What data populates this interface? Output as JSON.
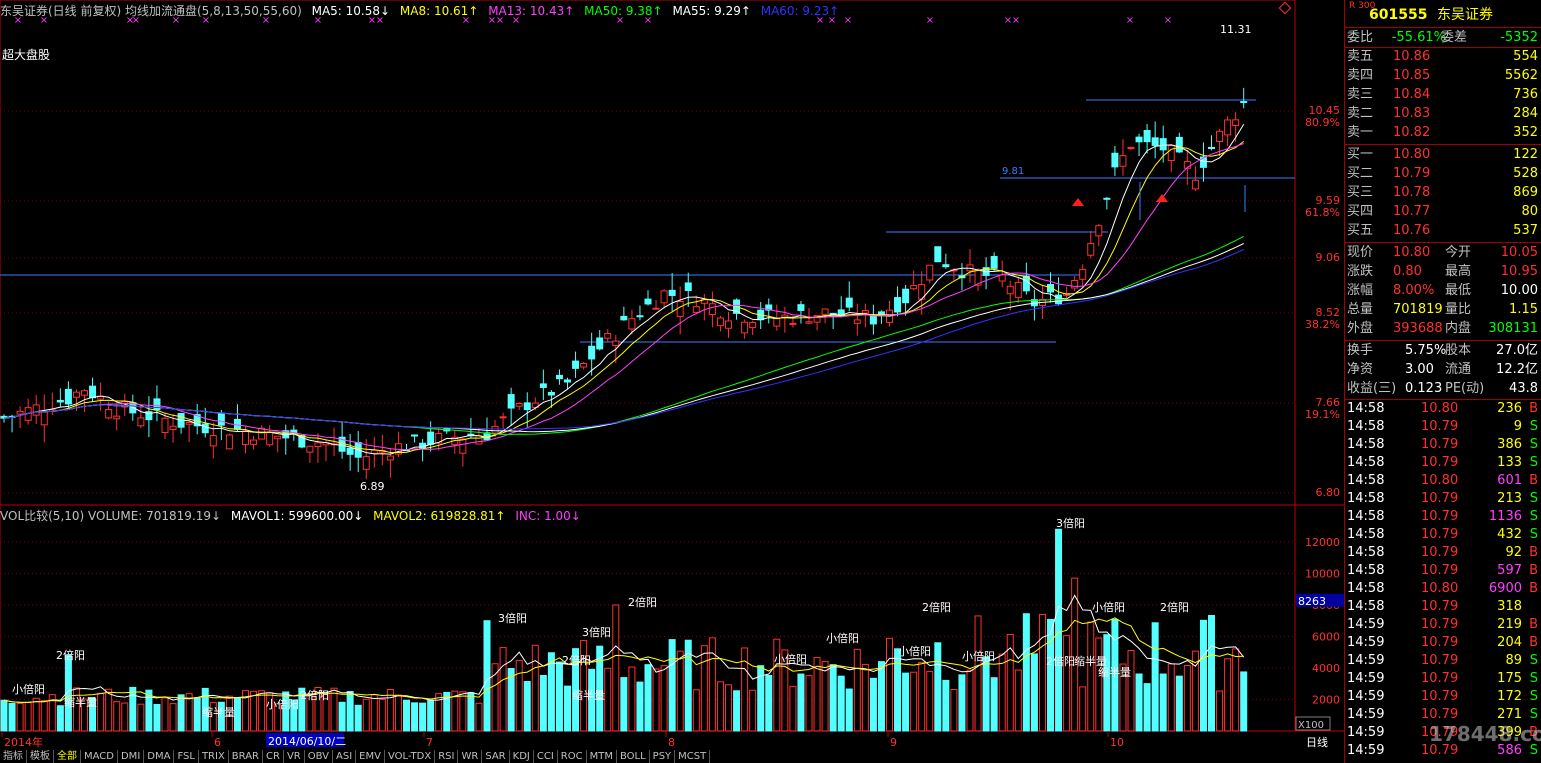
{
  "header": {
    "title": "东吴证券(日线 前复权) 均线加流通盘(5,8,13,50,55,60)",
    "ma": [
      {
        "label": "MA5: 10.58↓",
        "color": "#ffffff"
      },
      {
        "label": "MA8: 10.61↑",
        "color": "#ffff00"
      },
      {
        "label": "MA13: 10.43↑",
        "color": "#ff40ff"
      },
      {
        "label": "MA50: 9.38↑",
        "color": "#00ff00"
      },
      {
        "label": "MA55: 9.29↑",
        "color": "#ffffff"
      },
      {
        "label": "MA60: 9.23↑",
        "color": "#3333ff"
      }
    ],
    "board_label": "超大盘股"
  },
  "price_axis": [
    "10.45",
    "80.9%",
    "9.59",
    "61.8%",
    "9.06",
    "8.52",
    "38.2%",
    "7.66",
    "19.1%",
    "6.80"
  ],
  "annotations": {
    "high": "11.31",
    "low": "6.89",
    "level": "9.81"
  },
  "volume": {
    "header": [
      {
        "label": "VOL比较(5,10) VOLUME: 701819.19↓",
        "color": "#c0c0c0"
      },
      {
        "label": "MAVOL1: 599600.00↓",
        "color": "#ffffff"
      },
      {
        "label": "MAVOL2: 619828.81↑",
        "color": "#ffff00"
      },
      {
        "label": "INC: 1.00↓",
        "color": "#ff40ff"
      }
    ],
    "axis": [
      "12000",
      "10000",
      "8000",
      "6000",
      "4000",
      "2000"
    ],
    "cursor_value": "8263",
    "multiplier": "X100",
    "labels": [
      "小倍阳",
      "缩半量",
      "2倍阳",
      "缩半量",
      "小倍阳",
      "2倍阳",
      "3倍阳",
      "2倍阳",
      "缩半量",
      "3倍阳",
      "2倍阳",
      "小倍阳",
      "小倍阳",
      "2倍阳",
      "小倍阳",
      "小倍阳",
      "2倍阳",
      "缩半量",
      "3倍阳",
      "小倍阳",
      "缩半量",
      "2倍阳"
    ]
  },
  "date_axis": {
    "labels": [
      "2014年",
      "6",
      "7",
      "8",
      "9",
      "10"
    ],
    "selected_date": "2014/06/10/二",
    "period": "日线"
  },
  "tabs": [
    "指标",
    "模板",
    "全部",
    "MACD",
    "DMI",
    "DMA",
    "FSL",
    "TRIX",
    "BRAR",
    "CR",
    "VR",
    "OBV",
    "ASI",
    "EMV",
    "VOL-TDX",
    "RSI",
    "WR",
    "SAR",
    "KDJ",
    "CCI",
    "ROC",
    "MTM",
    "BOLL",
    "PSY",
    "MCST"
  ],
  "quote": {
    "code": "601555",
    "name": "东吴证券",
    "badge": "R 300",
    "weibi": {
      "label": "委比",
      "value": "-55.61%",
      "label2": "委差",
      "value2": "-5352"
    },
    "asks": [
      {
        "label": "卖五",
        "price": "10.86",
        "vol": "554"
      },
      {
        "label": "卖四",
        "price": "10.85",
        "vol": "5562"
      },
      {
        "label": "卖三",
        "price": "10.84",
        "vol": "736"
      },
      {
        "label": "卖二",
        "price": "10.83",
        "vol": "284"
      },
      {
        "label": "卖一",
        "price": "10.82",
        "vol": "352"
      }
    ],
    "bids": [
      {
        "label": "买一",
        "price": "10.80",
        "vol": "122"
      },
      {
        "label": "买二",
        "price": "10.79",
        "vol": "528"
      },
      {
        "label": "买三",
        "price": "10.78",
        "vol": "869"
      },
      {
        "label": "买四",
        "price": "10.77",
        "vol": "80"
      },
      {
        "label": "买五",
        "price": "10.76",
        "vol": "537"
      }
    ],
    "stats": [
      {
        "l1": "现价",
        "v1": "10.80",
        "l2": "今开",
        "v2": "10.05",
        "c1": "#ff3030",
        "c2": "#ff3030"
      },
      {
        "l1": "涨跌",
        "v1": "0.80",
        "l2": "最高",
        "v2": "10.95",
        "c1": "#ff3030",
        "c2": "#ff3030"
      },
      {
        "l1": "涨幅",
        "v1": "8.00%",
        "l2": "最低",
        "v2": "10.00",
        "c1": "#ff3030",
        "c2": "#ffffff"
      },
      {
        "l1": "总量",
        "v1": "701819",
        "l2": "量比",
        "v2": "1.15",
        "c1": "#ffff00",
        "c2": "#ffff00"
      },
      {
        "l1": "外盘",
        "v1": "393688",
        "l2": "内盘",
        "v2": "308131",
        "c1": "#ff3030",
        "c2": "#00ff00"
      }
    ],
    "stats2": [
      {
        "l1": "换手",
        "v1": "5.75%",
        "l2": "股本",
        "v2": "27.0亿"
      },
      {
        "l1": "净资",
        "v1": "3.00",
        "l2": "流通",
        "v2": "12.2亿"
      },
      {
        "l1": "收益(三)",
        "v1": "0.123",
        "l2": "PE(动)",
        "v2": "43.8"
      }
    ],
    "ticks": [
      {
        "t": "14:58",
        "p": "10.80",
        "v": "236",
        "s": "B"
      },
      {
        "t": "14:58",
        "p": "10.79",
        "v": "9",
        "s": "S"
      },
      {
        "t": "14:58",
        "p": "10.79",
        "v": "386",
        "s": "S"
      },
      {
        "t": "14:58",
        "p": "10.79",
        "v": "133",
        "s": "S"
      },
      {
        "t": "14:58",
        "p": "10.80",
        "v": "601",
        "s": "B"
      },
      {
        "t": "14:58",
        "p": "10.79",
        "v": "213",
        "s": "S"
      },
      {
        "t": "14:58",
        "p": "10.79",
        "v": "1136",
        "s": "S"
      },
      {
        "t": "14:58",
        "p": "10.79",
        "v": "432",
        "s": "S"
      },
      {
        "t": "14:58",
        "p": "10.79",
        "v": "92",
        "s": "B"
      },
      {
        "t": "14:58",
        "p": "10.79",
        "v": "597",
        "s": "B"
      },
      {
        "t": "14:58",
        "p": "10.80",
        "v": "6900",
        "s": "B"
      },
      {
        "t": "14:58",
        "p": "10.79",
        "v": "318",
        "s": ""
      },
      {
        "t": "14:59",
        "p": "10.79",
        "v": "219",
        "s": "B"
      },
      {
        "t": "14:59",
        "p": "10.79",
        "v": "204",
        "s": "B"
      },
      {
        "t": "14:59",
        "p": "10.79",
        "v": "89",
        "s": "S"
      },
      {
        "t": "14:59",
        "p": "10.79",
        "v": "175",
        "s": "S"
      },
      {
        "t": "14:59",
        "p": "10.79",
        "v": "172",
        "s": "S"
      },
      {
        "t": "14:59",
        "p": "10.79",
        "v": "271",
        "s": "S"
      },
      {
        "t": "14:59",
        "p": "10.79",
        "v": "399",
        "s": "B"
      },
      {
        "t": "14:59",
        "p": "10.79",
        "v": "586",
        "s": "S"
      }
    ],
    "watermark": "178448.com"
  },
  "colors": {
    "up": "#ff3030",
    "down": "#54ffff",
    "grid": "#800000",
    "axis": "#c00000"
  }
}
